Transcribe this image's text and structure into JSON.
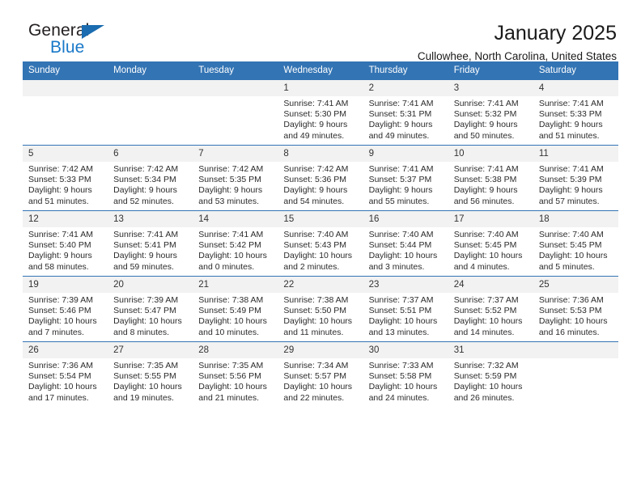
{
  "brand": {
    "name_top": "General",
    "name_bottom": "Blue",
    "accent_color": "#1878c8",
    "triangle_color": "#1b6cb0"
  },
  "header": {
    "title": "January 2025",
    "subtitle": "Cullowhee, North Carolina, United States"
  },
  "theme": {
    "header_row_bg": "#3374b4",
    "daynum_bg": "#f2f2f2",
    "grid_line": "#3374b4"
  },
  "weekdays": [
    "Sunday",
    "Monday",
    "Tuesday",
    "Wednesday",
    "Thursday",
    "Friday",
    "Saturday"
  ],
  "weeks": [
    [
      {
        "day": "",
        "lines": []
      },
      {
        "day": "",
        "lines": []
      },
      {
        "day": "",
        "lines": []
      },
      {
        "day": "1",
        "lines": [
          "Sunrise: 7:41 AM",
          "Sunset: 5:30 PM",
          "Daylight: 9 hours",
          "and 49 minutes."
        ]
      },
      {
        "day": "2",
        "lines": [
          "Sunrise: 7:41 AM",
          "Sunset: 5:31 PM",
          "Daylight: 9 hours",
          "and 49 minutes."
        ]
      },
      {
        "day": "3",
        "lines": [
          "Sunrise: 7:41 AM",
          "Sunset: 5:32 PM",
          "Daylight: 9 hours",
          "and 50 minutes."
        ]
      },
      {
        "day": "4",
        "lines": [
          "Sunrise: 7:41 AM",
          "Sunset: 5:33 PM",
          "Daylight: 9 hours",
          "and 51 minutes."
        ]
      }
    ],
    [
      {
        "day": "5",
        "lines": [
          "Sunrise: 7:42 AM",
          "Sunset: 5:33 PM",
          "Daylight: 9 hours",
          "and 51 minutes."
        ]
      },
      {
        "day": "6",
        "lines": [
          "Sunrise: 7:42 AM",
          "Sunset: 5:34 PM",
          "Daylight: 9 hours",
          "and 52 minutes."
        ]
      },
      {
        "day": "7",
        "lines": [
          "Sunrise: 7:42 AM",
          "Sunset: 5:35 PM",
          "Daylight: 9 hours",
          "and 53 minutes."
        ]
      },
      {
        "day": "8",
        "lines": [
          "Sunrise: 7:42 AM",
          "Sunset: 5:36 PM",
          "Daylight: 9 hours",
          "and 54 minutes."
        ]
      },
      {
        "day": "9",
        "lines": [
          "Sunrise: 7:41 AM",
          "Sunset: 5:37 PM",
          "Daylight: 9 hours",
          "and 55 minutes."
        ]
      },
      {
        "day": "10",
        "lines": [
          "Sunrise: 7:41 AM",
          "Sunset: 5:38 PM",
          "Daylight: 9 hours",
          "and 56 minutes."
        ]
      },
      {
        "day": "11",
        "lines": [
          "Sunrise: 7:41 AM",
          "Sunset: 5:39 PM",
          "Daylight: 9 hours",
          "and 57 minutes."
        ]
      }
    ],
    [
      {
        "day": "12",
        "lines": [
          "Sunrise: 7:41 AM",
          "Sunset: 5:40 PM",
          "Daylight: 9 hours",
          "and 58 minutes."
        ]
      },
      {
        "day": "13",
        "lines": [
          "Sunrise: 7:41 AM",
          "Sunset: 5:41 PM",
          "Daylight: 9 hours",
          "and 59 minutes."
        ]
      },
      {
        "day": "14",
        "lines": [
          "Sunrise: 7:41 AM",
          "Sunset: 5:42 PM",
          "Daylight: 10 hours",
          "and 0 minutes."
        ]
      },
      {
        "day": "15",
        "lines": [
          "Sunrise: 7:40 AM",
          "Sunset: 5:43 PM",
          "Daylight: 10 hours",
          "and 2 minutes."
        ]
      },
      {
        "day": "16",
        "lines": [
          "Sunrise: 7:40 AM",
          "Sunset: 5:44 PM",
          "Daylight: 10 hours",
          "and 3 minutes."
        ]
      },
      {
        "day": "17",
        "lines": [
          "Sunrise: 7:40 AM",
          "Sunset: 5:45 PM",
          "Daylight: 10 hours",
          "and 4 minutes."
        ]
      },
      {
        "day": "18",
        "lines": [
          "Sunrise: 7:40 AM",
          "Sunset: 5:45 PM",
          "Daylight: 10 hours",
          "and 5 minutes."
        ]
      }
    ],
    [
      {
        "day": "19",
        "lines": [
          "Sunrise: 7:39 AM",
          "Sunset: 5:46 PM",
          "Daylight: 10 hours",
          "and 7 minutes."
        ]
      },
      {
        "day": "20",
        "lines": [
          "Sunrise: 7:39 AM",
          "Sunset: 5:47 PM",
          "Daylight: 10 hours",
          "and 8 minutes."
        ]
      },
      {
        "day": "21",
        "lines": [
          "Sunrise: 7:38 AM",
          "Sunset: 5:49 PM",
          "Daylight: 10 hours",
          "and 10 minutes."
        ]
      },
      {
        "day": "22",
        "lines": [
          "Sunrise: 7:38 AM",
          "Sunset: 5:50 PM",
          "Daylight: 10 hours",
          "and 11 minutes."
        ]
      },
      {
        "day": "23",
        "lines": [
          "Sunrise: 7:37 AM",
          "Sunset: 5:51 PM",
          "Daylight: 10 hours",
          "and 13 minutes."
        ]
      },
      {
        "day": "24",
        "lines": [
          "Sunrise: 7:37 AM",
          "Sunset: 5:52 PM",
          "Daylight: 10 hours",
          "and 14 minutes."
        ]
      },
      {
        "day": "25",
        "lines": [
          "Sunrise: 7:36 AM",
          "Sunset: 5:53 PM",
          "Daylight: 10 hours",
          "and 16 minutes."
        ]
      }
    ],
    [
      {
        "day": "26",
        "lines": [
          "Sunrise: 7:36 AM",
          "Sunset: 5:54 PM",
          "Daylight: 10 hours",
          "and 17 minutes."
        ]
      },
      {
        "day": "27",
        "lines": [
          "Sunrise: 7:35 AM",
          "Sunset: 5:55 PM",
          "Daylight: 10 hours",
          "and 19 minutes."
        ]
      },
      {
        "day": "28",
        "lines": [
          "Sunrise: 7:35 AM",
          "Sunset: 5:56 PM",
          "Daylight: 10 hours",
          "and 21 minutes."
        ]
      },
      {
        "day": "29",
        "lines": [
          "Sunrise: 7:34 AM",
          "Sunset: 5:57 PM",
          "Daylight: 10 hours",
          "and 22 minutes."
        ]
      },
      {
        "day": "30",
        "lines": [
          "Sunrise: 7:33 AM",
          "Sunset: 5:58 PM",
          "Daylight: 10 hours",
          "and 24 minutes."
        ]
      },
      {
        "day": "31",
        "lines": [
          "Sunrise: 7:32 AM",
          "Sunset: 5:59 PM",
          "Daylight: 10 hours",
          "and 26 minutes."
        ]
      },
      {
        "day": "",
        "lines": []
      }
    ]
  ]
}
